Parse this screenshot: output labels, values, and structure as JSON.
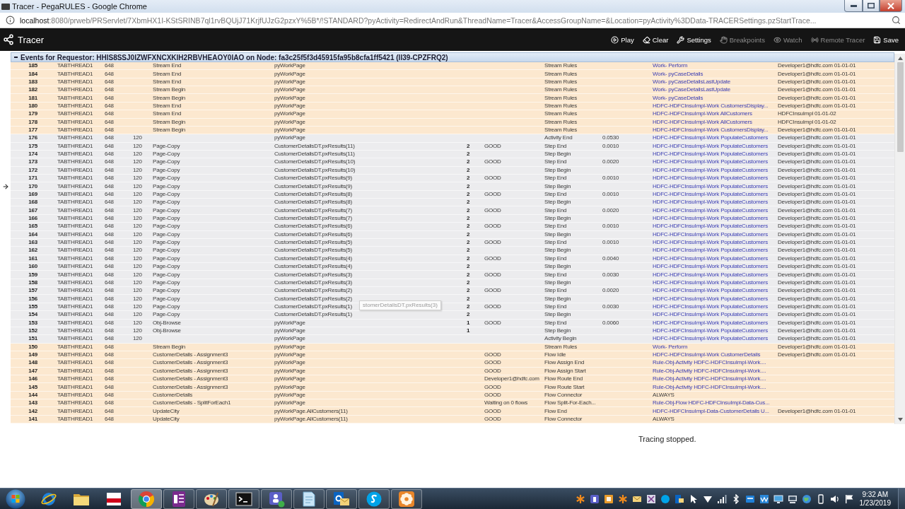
{
  "window": {
    "title": "Tracer - PegaRULES - Google Chrome"
  },
  "address_bar": {
    "host": "localhost",
    "path": ":8080/prweb/PRServlet/7XbmHX1I-KStSRINB7ql1rvBQUjJ71KrjfUJzG2pzxY%5B*/!STANDARD?pyActivity=RedirectAndRun&ThreadName=Tracer&AccessGroupName=&Location=pyActivity%3DData-TRACERSettings.pzStartTrace..."
  },
  "toolbar": {
    "title": "Tracer",
    "buttons": [
      {
        "label": "Play",
        "kind": "play",
        "disabled": false
      },
      {
        "label": "Clear",
        "kind": "clear",
        "disabled": false
      },
      {
        "label": "Settings",
        "kind": "settings",
        "disabled": false
      },
      {
        "label": "Breakpoints",
        "kind": "breakpoints",
        "disabled": true
      },
      {
        "label": "Watch",
        "kind": "watch",
        "disabled": true
      },
      {
        "label": "Remote Tracer",
        "kind": "remote",
        "disabled": true
      },
      {
        "label": "Save",
        "kind": "save",
        "disabled": false
      }
    ]
  },
  "events_header": {
    "text": "Events for Requestor: HHIS8SSJ0IZWFXNCXKIH2RBVHEAOY0IAO on Node: fa3c25f5f3d45915fa95b8cfa1ff5421 (II39-CPZFRQ2)"
  },
  "table": {
    "rows": [
      {
        "color": "#fce8cf",
        "marked": false,
        "linked": true,
        "column_1": "185",
        "column_2": "TABTHREAD1",
        "column_3": "648",
        "column_5": "Stream End",
        "column_6": "pyWorkPage",
        "column_9": "Stream Rules",
        "column_11": "Work- Perform",
        "column_12": "Developer1@hdfc.com 01-01-01"
      },
      {
        "color": "#fce8cf",
        "marked": false,
        "linked": true,
        "column_1": "184",
        "column_2": "TABTHREAD1",
        "column_3": "648",
        "column_5": "Stream End",
        "column_6": "pyWorkPage",
        "column_9": "Stream Rules",
        "column_11": "Work- pyCaseDetails",
        "column_12": "Developer1@hdfc.com 01-01-01"
      },
      {
        "color": "#fce8cf",
        "marked": false,
        "linked": true,
        "column_1": "183",
        "column_2": "TABTHREAD1",
        "column_3": "648",
        "column_5": "Stream End",
        "column_6": "pyWorkPage",
        "column_9": "Stream Rules",
        "column_11": "Work- pyCaseDetailsLastUpdate",
        "column_12": "Developer1@hdfc.com 01-01-01"
      },
      {
        "color": "#fce8cf",
        "marked": false,
        "linked": true,
        "column_1": "182",
        "column_2": "TABTHREAD1",
        "column_3": "648",
        "column_5": "Stream Begin",
        "column_6": "pyWorkPage",
        "column_9": "Stream Rules",
        "column_11": "Work- pyCaseDetailsLastUpdate",
        "column_12": "Developer1@hdfc.com 01-01-01"
      },
      {
        "color": "#fce8cf",
        "marked": false,
        "linked": true,
        "column_1": "181",
        "column_2": "TABTHREAD1",
        "column_3": "648",
        "column_5": "Stream Begin",
        "column_6": "pyWorkPage",
        "column_9": "Stream Rules",
        "column_11": "Work- pyCaseDetails",
        "column_12": "Developer1@hdfc.com 01-01-01"
      },
      {
        "color": "#fce8cf",
        "marked": false,
        "linked": true,
        "column_1": "180",
        "column_2": "TABTHREAD1",
        "column_3": "648",
        "column_5": "Stream End",
        "column_6": "pyWorkPage",
        "column_9": "Stream Rules",
        "column_11": "HDFC-HDFCInsuImpl-Work CustomersDisplay...",
        "column_12": "Developer1@hdfc.com 01-01-01"
      },
      {
        "color": "#fce8cf",
        "marked": false,
        "linked": true,
        "column_1": "179",
        "column_2": "TABTHREAD1",
        "column_3": "648",
        "column_5": "Stream End",
        "column_6": "pyWorkPage",
        "column_9": "Stream Rules",
        "column_11": "HDFC-HDFCInsuImpl-Work AllCustomers",
        "column_12": "HDFCInsuImpl 01-01-02"
      },
      {
        "color": "#fce8cf",
        "marked": false,
        "linked": true,
        "column_1": "178",
        "column_2": "TABTHREAD1",
        "column_3": "648",
        "column_5": "Stream Begin",
        "column_6": "pyWorkPage",
        "column_9": "Stream Rules",
        "column_11": "HDFC-HDFCInsuImpl-Work AllCustomers",
        "column_12": "HDFCInsuImpl 01-01-02"
      },
      {
        "color": "#fce8cf",
        "marked": false,
        "linked": true,
        "column_1": "177",
        "column_2": "TABTHREAD1",
        "column_3": "648",
        "column_5": "Stream Begin",
        "column_6": "pyWorkPage",
        "column_9": "Stream Rules",
        "column_11": "HDFC-HDFCInsuImpl-Work CustomersDisplay...",
        "column_12": "Developer1@hdfc.com 01-01-01"
      },
      {
        "color": "#ececee",
        "marked": false,
        "linked": true,
        "column_1": "176",
        "column_2": "TABTHREAD1",
        "column_3": "648",
        "column_4": "120",
        "column_6": "pyWorkPage",
        "column_9": "Activity End",
        "column_10": "0.0530",
        "column_11": "HDFC-HDFCInsuImpl-Work PopulateCustomers",
        "column_12": "Developer1@hdfc.com 01-01-01"
      },
      {
        "color": "#ececee",
        "marked": false,
        "linked": true,
        "column_1": "175",
        "column_2": "TABTHREAD1",
        "column_3": "648",
        "column_4": "120",
        "column_5": "Page-Copy",
        "column_6": "CustomerDetailsDT.pxResults(11)",
        "column_7": "2",
        "column_8": "GOOD",
        "column_9": "Step End",
        "column_10": "0.0010",
        "column_11": "HDFC-HDFCInsuImpl-Work PopulateCustomers",
        "column_12": "Developer1@hdfc.com 01-01-01"
      },
      {
        "color": "#ececee",
        "marked": false,
        "linked": true,
        "column_1": "174",
        "column_2": "TABTHREAD1",
        "column_3": "648",
        "column_4": "120",
        "column_5": "Page-Copy",
        "column_6": "CustomerDetailsDT.pxResults(11)",
        "column_7": "2",
        "column_9": "Step Begin",
        "column_11": "HDFC-HDFCInsuImpl-Work PopulateCustomers",
        "column_12": "Developer1@hdfc.com 01-01-01"
      },
      {
        "color": "#ececee",
        "marked": false,
        "linked": true,
        "column_1": "173",
        "column_2": "TABTHREAD1",
        "column_3": "648",
        "column_4": "120",
        "column_5": "Page-Copy",
        "column_6": "CustomerDetailsDT.pxResults(10)",
        "column_7": "2",
        "column_8": "GOOD",
        "column_9": "Step End",
        "column_10": "0.0020",
        "column_11": "HDFC-HDFCInsuImpl-Work PopulateCustomers",
        "column_12": "Developer1@hdfc.com 01-01-01"
      },
      {
        "color": "#ececee",
        "marked": false,
        "linked": true,
        "column_1": "172",
        "column_2": "TABTHREAD1",
        "column_3": "648",
        "column_4": "120",
        "column_5": "Page-Copy",
        "column_6": "CustomerDetailsDT.pxResults(10)",
        "column_7": "2",
        "column_9": "Step Begin",
        "column_11": "HDFC-HDFCInsuImpl-Work PopulateCustomers",
        "column_12": "Developer1@hdfc.com 01-01-01"
      },
      {
        "color": "#ececee",
        "marked": false,
        "linked": true,
        "column_1": "171",
        "column_2": "TABTHREAD1",
        "column_3": "648",
        "column_4": "120",
        "column_5": "Page-Copy",
        "column_6": "CustomerDetailsDT.pxResults(9)",
        "column_7": "2",
        "column_8": "GOOD",
        "column_9": "Step End",
        "column_10": "0.0010",
        "column_11": "HDFC-HDFCInsuImpl-Work PopulateCustomers",
        "column_12": "Developer1@hdfc.com 01-01-01"
      },
      {
        "color": "#ececee",
        "marked": true,
        "linked": true,
        "column_1": "170",
        "column_2": "TABTHREAD1",
        "column_3": "648",
        "column_4": "120",
        "column_5": "Page-Copy",
        "column_6": "CustomerDetailsDT.pxResults(9)",
        "column_7": "2",
        "column_9": "Step Begin",
        "column_11": "HDFC-HDFCInsuImpl-Work PopulateCustomers",
        "column_12": "Developer1@hdfc.com 01-01-01"
      },
      {
        "color": "#ececee",
        "marked": false,
        "linked": true,
        "column_1": "169",
        "column_2": "TABTHREAD1",
        "column_3": "648",
        "column_4": "120",
        "column_5": "Page-Copy",
        "column_6": "CustomerDetailsDT.pxResults(8)",
        "column_7": "2",
        "column_8": "GOOD",
        "column_9": "Step End",
        "column_10": "0.0010",
        "column_11": "HDFC-HDFCInsuImpl-Work PopulateCustomers",
        "column_12": "Developer1@hdfc.com 01-01-01"
      },
      {
        "color": "#ececee",
        "marked": false,
        "linked": true,
        "column_1": "168",
        "column_2": "TABTHREAD1",
        "column_3": "648",
        "column_4": "120",
        "column_5": "Page-Copy",
        "column_6": "CustomerDetailsDT.pxResults(8)",
        "column_7": "2",
        "column_9": "Step Begin",
        "column_11": "HDFC-HDFCInsuImpl-Work PopulateCustomers",
        "column_12": "Developer1@hdfc.com 01-01-01"
      },
      {
        "color": "#ececee",
        "marked": false,
        "linked": true,
        "column_1": "167",
        "column_2": "TABTHREAD1",
        "column_3": "648",
        "column_4": "120",
        "column_5": "Page-Copy",
        "column_6": "CustomerDetailsDT.pxResults(7)",
        "column_7": "2",
        "column_8": "GOOD",
        "column_9": "Step End",
        "column_10": "0.0020",
        "column_11": "HDFC-HDFCInsuImpl-Work PopulateCustomers",
        "column_12": "Developer1@hdfc.com 01-01-01"
      },
      {
        "color": "#ececee",
        "marked": false,
        "linked": true,
        "column_1": "166",
        "column_2": "TABTHREAD1",
        "column_3": "648",
        "column_4": "120",
        "column_5": "Page-Copy",
        "column_6": "CustomerDetailsDT.pxResults(7)",
        "column_7": "2",
        "column_9": "Step Begin",
        "column_11": "HDFC-HDFCInsuImpl-Work PopulateCustomers",
        "column_12": "Developer1@hdfc.com 01-01-01"
      },
      {
        "color": "#ececee",
        "marked": false,
        "linked": true,
        "column_1": "165",
        "column_2": "TABTHREAD1",
        "column_3": "648",
        "column_4": "120",
        "column_5": "Page-Copy",
        "column_6": "CustomerDetailsDT.pxResults(6)",
        "column_7": "2",
        "column_8": "GOOD",
        "column_9": "Step End",
        "column_10": "0.0010",
        "column_11": "HDFC-HDFCInsuImpl-Work PopulateCustomers",
        "column_12": "Developer1@hdfc.com 01-01-01"
      },
      {
        "color": "#ececee",
        "marked": false,
        "linked": true,
        "column_1": "164",
        "column_2": "TABTHREAD1",
        "column_3": "648",
        "column_4": "120",
        "column_5": "Page-Copy",
        "column_6": "CustomerDetailsDT.pxResults(6)",
        "column_7": "2",
        "column_9": "Step Begin",
        "column_11": "HDFC-HDFCInsuImpl-Work PopulateCustomers",
        "column_12": "Developer1@hdfc.com 01-01-01"
      },
      {
        "color": "#ececee",
        "marked": false,
        "linked": true,
        "column_1": "163",
        "column_2": "TABTHREAD1",
        "column_3": "648",
        "column_4": "120",
        "column_5": "Page-Copy",
        "column_6": "CustomerDetailsDT.pxResults(5)",
        "column_7": "2",
        "column_8": "GOOD",
        "column_9": "Step End",
        "column_10": "0.0010",
        "column_11": "HDFC-HDFCInsuImpl-Work PopulateCustomers",
        "column_12": "Developer1@hdfc.com 01-01-01"
      },
      {
        "color": "#ececee",
        "marked": false,
        "linked": true,
        "column_1": "162",
        "column_2": "TABTHREAD1",
        "column_3": "648",
        "column_4": "120",
        "column_5": "Page-Copy",
        "column_6": "CustomerDetailsDT.pxResults(5)",
        "column_7": "2",
        "column_9": "Step Begin",
        "column_11": "HDFC-HDFCInsuImpl-Work PopulateCustomers",
        "column_12": "Developer1@hdfc.com 01-01-01"
      },
      {
        "color": "#ececee",
        "marked": false,
        "linked": true,
        "column_1": "161",
        "column_2": "TABTHREAD1",
        "column_3": "648",
        "column_4": "120",
        "column_5": "Page-Copy",
        "column_6": "CustomerDetailsDT.pxResults(4)",
        "column_7": "2",
        "column_8": "GOOD",
        "column_9": "Step End",
        "column_10": "0.0040",
        "column_11": "HDFC-HDFCInsuImpl-Work PopulateCustomers",
        "column_12": "Developer1@hdfc.com 01-01-01"
      },
      {
        "color": "#ececee",
        "marked": false,
        "linked": true,
        "column_1": "160",
        "column_2": "TABTHREAD1",
        "column_3": "648",
        "column_4": "120",
        "column_5": "Page-Copy",
        "column_6": "CustomerDetailsDT.pxResults(4)",
        "column_7": "2",
        "column_9": "Step Begin",
        "column_11": "HDFC-HDFCInsuImpl-Work PopulateCustomers",
        "column_12": "Developer1@hdfc.com 01-01-01"
      },
      {
        "color": "#ececee",
        "marked": false,
        "linked": true,
        "column_1": "159",
        "column_2": "TABTHREAD1",
        "column_3": "648",
        "column_4": "120",
        "column_5": "Page-Copy",
        "column_6": "CustomerDetailsDT.pxResults(3)",
        "column_7": "2",
        "column_8": "GOOD",
        "column_9": "Step End",
        "column_10": "0.0030",
        "column_11": "HDFC-HDFCInsuImpl-Work PopulateCustomers",
        "column_12": "Developer1@hdfc.com 01-01-01"
      },
      {
        "color": "#ececee",
        "marked": false,
        "linked": true,
        "column_1": "158",
        "column_2": "TABTHREAD1",
        "column_3": "648",
        "column_4": "120",
        "column_5": "Page-Copy",
        "column_6": "CustomerDetailsDT.pxResults(3)",
        "column_7": "2",
        "column_9": "Step Begin",
        "column_11": "HDFC-HDFCInsuImpl-Work PopulateCustomers",
        "column_12": "Developer1@hdfc.com 01-01-01"
      },
      {
        "color": "#ececee",
        "marked": false,
        "linked": true,
        "column_1": "157",
        "column_2": "TABTHREAD1",
        "column_3": "648",
        "column_4": "120",
        "column_5": "Page-Copy",
        "column_6": "CustomerDetailsDT.pxResults(2)",
        "column_7": "2",
        "column_8": "GOOD",
        "column_9": "Step End",
        "column_10": "0.0020",
        "column_11": "HDFC-HDFCInsuImpl-Work PopulateCustomers",
        "column_12": "Developer1@hdfc.com 01-01-01"
      },
      {
        "color": "#ececee",
        "marked": false,
        "linked": true,
        "column_1": "156",
        "column_2": "TABTHREAD1",
        "column_3": "648",
        "column_4": "120",
        "column_5": "Page-Copy",
        "column_6": "CustomerDetailsDT.pxResults(2)",
        "column_7": "2",
        "column_9": "Step Begin",
        "column_11": "HDFC-HDFCInsuImpl-Work PopulateCustomers",
        "column_12": "Developer1@hdfc.com 01-01-01"
      },
      {
        "color": "#ececee",
        "marked": false,
        "linked": true,
        "column_1": "155",
        "column_2": "TABTHREAD1",
        "column_3": "648",
        "column_4": "120",
        "column_5": "Page-Copy",
        "column_6": "CustomerDetailsDT.pxResults(1)",
        "column_7": "2",
        "column_8": "GOOD",
        "column_9": "Step End",
        "column_10": "0.0030",
        "column_11": "HDFC-HDFCInsuImpl-Work PopulateCustomers",
        "column_12": "Developer1@hdfc.com 01-01-01"
      },
      {
        "color": "#ececee",
        "marked": false,
        "linked": true,
        "column_1": "154",
        "column_2": "TABTHREAD1",
        "column_3": "648",
        "column_4": "120",
        "column_5": "Page-Copy",
        "column_6": "CustomerDetailsDT.pxResults(1)",
        "column_7": "2",
        "column_9": "Step Begin",
        "column_11": "HDFC-HDFCInsuImpl-Work PopulateCustomers",
        "column_12": "Developer1@hdfc.com 01-01-01"
      },
      {
        "color": "#ececee",
        "marked": false,
        "linked": true,
        "column_1": "153",
        "column_2": "TABTHREAD1",
        "column_3": "648",
        "column_4": "120",
        "column_5": "Obj-Browse",
        "column_6": "pyWorkPage",
        "column_7": "1",
        "column_8": "GOOD",
        "column_9": "Step End",
        "column_10": "0.0060",
        "column_11": "HDFC-HDFCInsuImpl-Work PopulateCustomers",
        "column_12": "Developer1@hdfc.com 01-01-01"
      },
      {
        "color": "#ececee",
        "marked": false,
        "linked": true,
        "column_1": "152",
        "column_2": "TABTHREAD1",
        "column_3": "648",
        "column_4": "120",
        "column_5": "Obj-Browse",
        "column_6": "pyWorkPage",
        "column_7": "1",
        "column_9": "Step Begin",
        "column_11": "HDFC-HDFCInsuImpl-Work PopulateCustomers",
        "column_12": "Developer1@hdfc.com 01-01-01"
      },
      {
        "color": "#ececee",
        "marked": false,
        "linked": true,
        "column_1": "151",
        "column_2": "TABTHREAD1",
        "column_3": "648",
        "column_4": "120",
        "column_6": "pyWorkPage",
        "column_9": "Activity Begin",
        "column_11": "HDFC-HDFCInsuImpl-Work PopulateCustomers",
        "column_12": "Developer1@hdfc.com 01-01-01"
      },
      {
        "color": "#fce8cf",
        "marked": false,
        "linked": true,
        "column_1": "150",
        "column_2": "TABTHREAD1",
        "column_3": "648",
        "column_5": "Stream Begin",
        "column_6": "pyWorkPage",
        "column_9": "Stream Rules",
        "column_11": "Work- Perform",
        "column_12": "Developer1@hdfc.com 01-01-01"
      },
      {
        "color": "#fce8cf",
        "marked": false,
        "linked": true,
        "column_1": "149",
        "column_2": "TABTHREAD1",
        "column_3": "648",
        "column_5": "CustomerDetails - Assignment3",
        "column_6": "pyWorkPage",
        "column_8": "GOOD",
        "column_9": "Flow Idle",
        "column_11": "HDFC-HDFCInsuImpl-Work CustomerDetails",
        "column_12": "Developer1@hdfc.com 01-01-01"
      },
      {
        "color": "#fce8cf",
        "marked": false,
        "linked": true,
        "column_1": "148",
        "column_2": "TABTHREAD1",
        "column_3": "648",
        "column_5": "CustomerDetails - Assignment3",
        "column_6": "pyWorkPage",
        "column_8": "GOOD",
        "column_9": "Flow Assign End",
        "column_11": "Rule-Obj-Activity HDFC-HDFCInsuImpl-Work...."
      },
      {
        "color": "#fce8cf",
        "marked": false,
        "linked": true,
        "column_1": "147",
        "column_2": "TABTHREAD1",
        "column_3": "648",
        "column_5": "CustomerDetails - Assignment3",
        "column_6": "pyWorkPage",
        "column_8": "GOOD",
        "column_9": "Flow Assign Start",
        "column_11": "Rule-Obj-Activity HDFC-HDFCInsuImpl-Work...."
      },
      {
        "color": "#fce8cf",
        "marked": false,
        "linked": true,
        "column_1": "146",
        "column_2": "TABTHREAD1",
        "column_3": "648",
        "column_5": "CustomerDetails - Assignment3",
        "column_6": "pyWorkPage",
        "column_8": "Developer1@hdfc.com",
        "column_9": "Flow Route End",
        "column_11": "Rule-Obj-Activity HDFC-HDFCInsuImpl-Work...."
      },
      {
        "color": "#fce8cf",
        "marked": false,
        "linked": true,
        "column_1": "145",
        "column_2": "TABTHREAD1",
        "column_3": "648",
        "column_5": "CustomerDetails - Assignment3",
        "column_6": "pyWorkPage",
        "column_8": "GOOD",
        "column_9": "Flow Route Start",
        "column_11": "Rule-Obj-Activity HDFC-HDFCInsuImpl-Work...."
      },
      {
        "color": "#fce8cf",
        "marked": false,
        "linked": false,
        "column_1": "144",
        "column_2": "TABTHREAD1",
        "column_3": "648",
        "column_5": "CustomerDetails",
        "column_6": "pyWorkPage",
        "column_8": "GOOD",
        "column_9": "Flow Connector",
        "column_11": "ALWAYS"
      },
      {
        "color": "#fce8cf",
        "marked": false,
        "linked": true,
        "column_1": "143",
        "column_2": "TABTHREAD1",
        "column_3": "648",
        "column_5": "CustomerDetails - SplitForEach1",
        "column_6": "pyWorkPage",
        "column_8": "Waiting on 0 flows",
        "column_9": "Flow Split-For-Each...",
        "column_11": "Rule-Obj-Flow HDFC-HDFCInsuImpl-Data-Cus..."
      },
      {
        "color": "#fce8cf",
        "marked": false,
        "linked": true,
        "column_1": "142",
        "column_2": "TABTHREAD1",
        "column_3": "648",
        "column_5": "UpdateCity",
        "column_6": "pyWorkPage.AllCustomers(11)",
        "column_8": "GOOD",
        "column_9": "Flow End",
        "column_11": "HDFC-HDFCInsuImpl-Data-CustomerDetails U...",
        "column_12": "Developer1@hdfc.com 01-01-01"
      },
      {
        "color": "#fce8cf",
        "marked": false,
        "linked": false,
        "column_1": "141",
        "column_2": "TABTHREAD1",
        "column_3": "648",
        "column_5": "UpdateCity",
        "column_6": "pyWorkPage.AllCustomers(11)",
        "column_8": "GOOD",
        "column_9": "Flow Connector",
        "column_11": "ALWAYS"
      }
    ]
  },
  "tooltip": {
    "text": "stomerDetailsDT.pxResults(3)"
  },
  "status": {
    "text": "Tracing stopped."
  },
  "taskbar": {
    "apps": [
      {
        "kind": "globe",
        "running": false,
        "selected": false
      },
      {
        "kind": "folder",
        "running": false,
        "selected": false
      },
      {
        "kind": "banner",
        "running": false,
        "selected": false
      },
      {
        "kind": "wheel",
        "running": true,
        "selected": true
      },
      {
        "kind": "notebook",
        "running": true,
        "selected": false
      },
      {
        "kind": "palette",
        "running": true,
        "selected": false
      },
      {
        "kind": "terminal",
        "running": true,
        "selected": false
      },
      {
        "kind": "team",
        "running": true,
        "selected": false
      },
      {
        "kind": "notepad",
        "running": true,
        "selected": false
      },
      {
        "kind": "mail",
        "running": true,
        "selected": false
      },
      {
        "kind": "chat",
        "running": true,
        "selected": false
      },
      {
        "kind": "flower",
        "running": true,
        "selected": false
      }
    ],
    "time": "9:32 AM",
    "date": "1/23/2019"
  }
}
